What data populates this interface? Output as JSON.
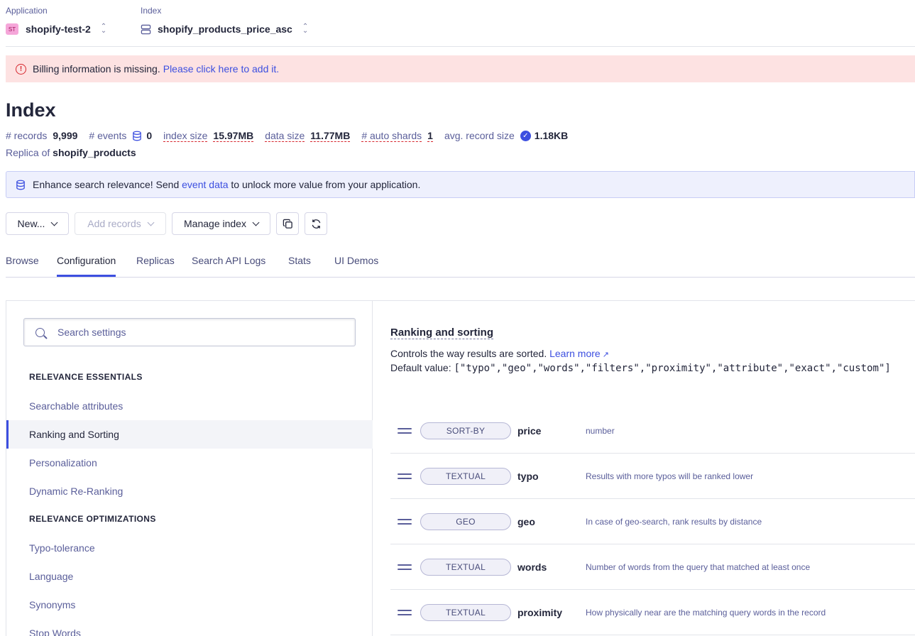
{
  "header": {
    "application_label": "Application",
    "application_badge": "ST",
    "application_name": "shopify-test-2",
    "index_label": "Index",
    "index_name": "shopify_products_price_asc"
  },
  "billing": {
    "message": "Billing information is missing.",
    "link": "Please click here to add it."
  },
  "index": {
    "title": "Index",
    "records_label": "# records",
    "records_value": "9,999",
    "events_label": "# events",
    "events_value": "0",
    "index_size_label": "index size",
    "index_size_value": "15.97MB",
    "data_size_label": "data size",
    "data_size_value": "11.77MB",
    "auto_shards_label": "# auto shards",
    "auto_shards_value": "1",
    "avg_record_label": "avg. record size",
    "avg_record_value": "1.18KB",
    "replica_label": "Replica of",
    "replica_value": "shopify_products"
  },
  "banner": {
    "prefix": "Enhance search relevance! Send",
    "link": "event data",
    "suffix": "to unlock more value from your application."
  },
  "toolbar": {
    "new_label": "New...",
    "add_records_label": "Add records",
    "manage_index_label": "Manage index"
  },
  "tabs": [
    "Browse",
    "Configuration",
    "Replicas",
    "Search API Logs",
    "Stats",
    "UI Demos"
  ],
  "settings": {
    "search_placeholder": "Search settings",
    "section_essentials": "RELEVANCE ESSENTIALS",
    "section_optimizations": "RELEVANCE OPTIMIZATIONS",
    "nav_items": [
      "Searchable attributes",
      "Ranking and Sorting",
      "Personalization",
      "Dynamic Re-Ranking",
      "Typo-tolerance",
      "Language",
      "Synonyms",
      "Stop Words"
    ]
  },
  "ranking": {
    "title": "Ranking and sorting",
    "description": "Controls the way results are sorted.",
    "learn_more": "Learn more",
    "default_label": "Default value:",
    "default_value": "[\"typo\",\"geo\",\"words\",\"filters\",\"proximity\",\"attribute\",\"exact\",\"custom\"]",
    "rows": [
      {
        "type": "SORT-BY",
        "name": "price",
        "desc": "number"
      },
      {
        "type": "TEXTUAL",
        "name": "typo",
        "desc": "Results with more typos will be ranked lower"
      },
      {
        "type": "GEO",
        "name": "geo",
        "desc": "In case of geo-search, rank results by distance"
      },
      {
        "type": "TEXTUAL",
        "name": "words",
        "desc": "Number of words from the query that matched at least once"
      },
      {
        "type": "TEXTUAL",
        "name": "proximity",
        "desc": "How physically near are the matching query words in the record"
      }
    ]
  },
  "colors": {
    "accent": "#3c4fe0",
    "error": "#d6272e",
    "billing_bg": "#fde2e2",
    "banner_bg": "#eef0fd"
  }
}
